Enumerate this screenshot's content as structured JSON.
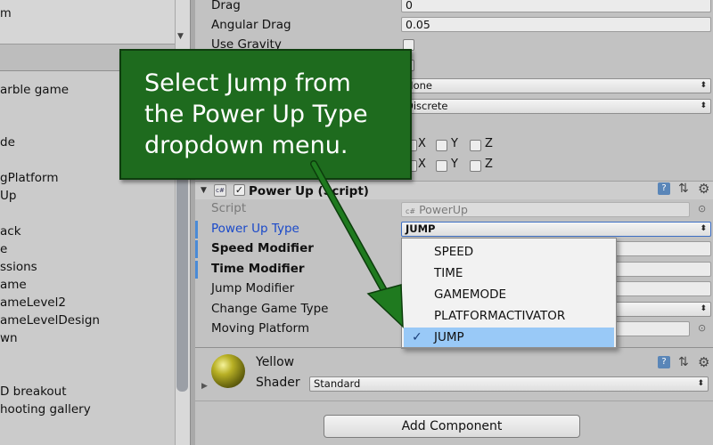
{
  "hierarchy": {
    "top_item": "m",
    "items": [
      "arble game",
      "",
      "de",
      "gPlatform",
      "Up",
      "ack",
      "e",
      "ssions",
      "ame",
      "ameLevel2",
      "ameLevelDesign",
      "wn",
      "",
      "D breakout",
      "hooting gallery"
    ]
  },
  "rigidbody": {
    "drag_label": "Drag",
    "drag_value": "0",
    "angular_drag_label": "Angular Drag",
    "angular_drag_value": "0.05",
    "use_gravity_label": "Use Gravity",
    "interpolate_value": "None",
    "collision_value": "Discrete",
    "axis_x": "X",
    "axis_y": "Y",
    "axis_z": "Z"
  },
  "component": {
    "title": "Power Up (Script)",
    "script_label": "Script",
    "script_value": "PowerUp",
    "fields": [
      {
        "label": "Power Up Type"
      },
      {
        "label": "Speed Modifier"
      },
      {
        "label": "Time Modifier"
      },
      {
        "label": "Jump Modifier"
      },
      {
        "label": "Change Game Type"
      },
      {
        "label": "Moving Platform"
      }
    ],
    "power_up_type_value": "JUMP"
  },
  "popup": {
    "options": [
      "SPEED",
      "TIME",
      "GAMEMODE",
      "PLATFORMACTIVATOR",
      "JUMP"
    ],
    "selected": "JUMP",
    "check_glyph": "✓"
  },
  "material": {
    "name": "Yellow",
    "shader_label": "Shader",
    "shader_value": "Standard"
  },
  "add_component_label": "Add Component",
  "callout": {
    "line1": "Select Jump from",
    "line2": "the Power Up Type",
    "line3": "dropdown menu."
  },
  "icons": {
    "dropdown_arrow": "⬍",
    "script_icon": "c#",
    "help_icon": "?",
    "settings_icon": "⚙",
    "preset_icon": "⇅"
  },
  "colors": {
    "callout_bg": "#1e6b1e",
    "arrow": "#1f7a1f",
    "selection": "#99c9f7",
    "label_blue": "#1a49c9"
  }
}
